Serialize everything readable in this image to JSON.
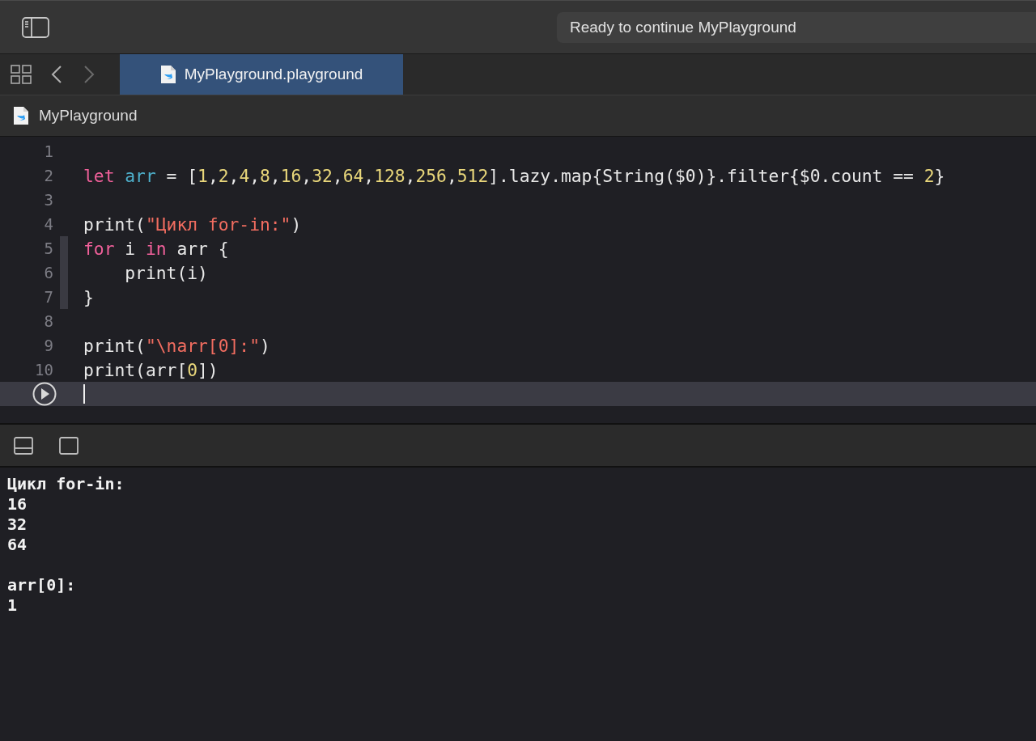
{
  "toolbar": {
    "status": "Ready to continue MyPlayground"
  },
  "tabs": [
    {
      "label": "MyPlayground.playground",
      "selected": true
    }
  ],
  "breadcrumb": {
    "label": "MyPlayground"
  },
  "editor": {
    "lines": [
      {
        "number": "1",
        "current": false,
        "in_scope": false
      },
      {
        "number": "2",
        "current": false,
        "in_scope": false,
        "tokens": [
          {
            "kind": "kw",
            "text": "let"
          },
          {
            "kind": "var",
            "text": " arr"
          },
          {
            "kind": "plain",
            "text": " = ["
          },
          {
            "kind": "num",
            "text": "1"
          },
          {
            "kind": "plain",
            "text": ","
          },
          {
            "kind": "num",
            "text": "2"
          },
          {
            "kind": "plain",
            "text": ","
          },
          {
            "kind": "num",
            "text": "4"
          },
          {
            "kind": "plain",
            "text": ","
          },
          {
            "kind": "num",
            "text": "8"
          },
          {
            "kind": "plain",
            "text": ","
          },
          {
            "kind": "num",
            "text": "16"
          },
          {
            "kind": "plain",
            "text": ","
          },
          {
            "kind": "num",
            "text": "32"
          },
          {
            "kind": "plain",
            "text": ","
          },
          {
            "kind": "num",
            "text": "64"
          },
          {
            "kind": "plain",
            "text": ","
          },
          {
            "kind": "num",
            "text": "128"
          },
          {
            "kind": "plain",
            "text": ","
          },
          {
            "kind": "num",
            "text": "256"
          },
          {
            "kind": "plain",
            "text": ","
          },
          {
            "kind": "num",
            "text": "512"
          },
          {
            "kind": "plain",
            "text": "].lazy.map{String($0)}.filter{$0.count == "
          },
          {
            "kind": "num",
            "text": "2"
          },
          {
            "kind": "plain",
            "text": "}"
          }
        ]
      },
      {
        "number": "3",
        "current": false,
        "in_scope": false
      },
      {
        "number": "4",
        "current": false,
        "in_scope": false,
        "tokens": [
          {
            "kind": "plain",
            "text": "print("
          },
          {
            "kind": "str",
            "text": "\"Цикл for-in:\""
          },
          {
            "kind": "plain",
            "text": ")"
          }
        ]
      },
      {
        "number": "5",
        "current": false,
        "in_scope": true,
        "tokens": [
          {
            "kind": "kw",
            "text": "for"
          },
          {
            "kind": "plain",
            "text": " i "
          },
          {
            "kind": "kw",
            "text": "in"
          },
          {
            "kind": "plain",
            "text": " arr {"
          }
        ]
      },
      {
        "number": "6",
        "current": false,
        "in_scope": true,
        "tokens": [
          {
            "kind": "plain",
            "text": "    print(i)"
          }
        ]
      },
      {
        "number": "7",
        "current": false,
        "in_scope": true,
        "tokens": [
          {
            "kind": "plain",
            "text": "}"
          }
        ]
      },
      {
        "number": "8",
        "current": false,
        "in_scope": false
      },
      {
        "number": "9",
        "current": false,
        "in_scope": false,
        "tokens": [
          {
            "kind": "plain",
            "text": "print("
          },
          {
            "kind": "str",
            "text": "\"\\narr[0]:\""
          },
          {
            "kind": "plain",
            "text": ")"
          }
        ]
      },
      {
        "number": "10",
        "current": false,
        "in_scope": false,
        "tokens": [
          {
            "kind": "plain",
            "text": "print(arr["
          },
          {
            "kind": "num",
            "text": "0"
          },
          {
            "kind": "plain",
            "text": "])"
          }
        ]
      },
      {
        "current": true,
        "in_scope": false
      }
    ]
  },
  "console": {
    "groups": [
      [
        "Цикл for-in:",
        "16",
        "32",
        "64"
      ],
      [
        "arr[0]:",
        "1"
      ]
    ]
  }
}
